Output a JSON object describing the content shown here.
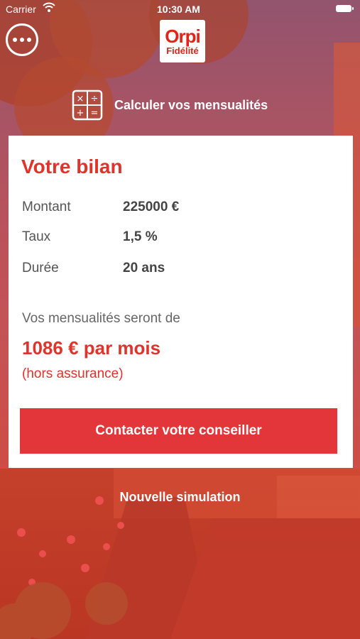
{
  "status_bar": {
    "carrier": "Carrier",
    "time": "10:30 AM"
  },
  "header": {
    "menu_icon": "more-dots-icon",
    "logo_main": "Orpi",
    "logo_sub": "Fidélité"
  },
  "calculator": {
    "icon": "calculator-icon",
    "label": "Calculer vos mensualités"
  },
  "summary": {
    "title": "Votre bilan",
    "rows": [
      {
        "label": "Montant",
        "value": "225000 €"
      },
      {
        "label": "Taux",
        "value": "1,5 %"
      },
      {
        "label": "Durée",
        "value": "20 ans"
      }
    ],
    "intro": "Vos mensualités seront de",
    "monthly": "1086 € par mois",
    "note": "(hors assurance)",
    "cta_label": "Contacter votre conseiller"
  },
  "new_simulation_label": "Nouvelle simulation",
  "colors": {
    "accent": "#e0332b",
    "button": "#e2363a"
  }
}
